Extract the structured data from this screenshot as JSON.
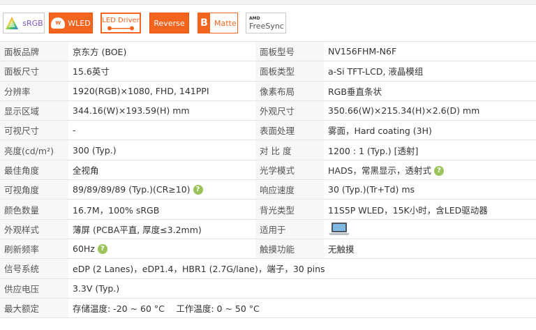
{
  "badges": {
    "srgb": "sRGB",
    "wled_bulb": "W",
    "wled": "WLED",
    "led_driver": "LED Driver",
    "reverse": "Reverse",
    "matte_letter": "B",
    "matte": "Matte",
    "amd": "AMD",
    "freesync": "FreeSync"
  },
  "colors": {
    "accent": "#f3641e",
    "help": "#9cc35a",
    "label_bg": "#f7f7f7",
    "border": "#e4e4e4"
  },
  "help_icon": "?",
  "specs": {
    "r1": {
      "k1": "面板品牌",
      "v1": "京东方 (BOE)",
      "k2": "面板型号",
      "v2": "NV156FHM-N6F"
    },
    "r2": {
      "k1": "面板尺寸",
      "v1": "15.6英寸",
      "k2": "面板类型",
      "v2": "a-Si TFT-LCD, 液晶模组"
    },
    "r3": {
      "k1": "分辨率",
      "v1": "1920(RGB)×1080, FHD, 141PPI",
      "k2": "像素布局",
      "v2": "RGB垂直条状"
    },
    "r4": {
      "k1": "显示区域",
      "v1": "344.16(W)×193.59(H) mm",
      "k2": "外观尺寸",
      "v2": "350.66(W)×215.34(H)×2.6(D) mm"
    },
    "r5": {
      "k1": "可视尺寸",
      "v1": "-",
      "k2": "表面处理",
      "v2": "雾面，Hard coating (3H)"
    },
    "r6": {
      "k1": "亮度(cd/m²)",
      "v1": "300 (Typ.)",
      "k2": "对 比 度",
      "v2": "1200 : 1 (Typ.) [透射]"
    },
    "r7": {
      "k1": "最佳角度",
      "v1": "全视角",
      "k2": "光学模式",
      "v2": "HADS，常黑显示，透射式"
    },
    "r8": {
      "k1": "可视角度",
      "v1": "89/89/89/89 (Typ.)(CR≥10)",
      "k2": "响应速度",
      "v2": "30 (Typ.)(Tr+Td) ms"
    },
    "r9": {
      "k1": "颜色数量",
      "v1": "16.7M，100% sRGB",
      "k2": "背光类型",
      "v2": "11S5P WLED，15K小时，含LED驱动器"
    },
    "r10": {
      "k1": "外观样式",
      "v1": "薄屏 (PCBA平直, 厚度≤3.2mm)",
      "k2": "适用于",
      "v2_icon": "laptop-icon"
    },
    "r11": {
      "k1": "刷新频率",
      "v1": "60Hz",
      "k2": "触摸功能",
      "v2": "无触摸"
    },
    "r12": {
      "k1": "信号系统",
      "v1": "eDP (2 Lanes)，eDP1.4，HBR1 (2.7G/lane)，端子，30 pins"
    },
    "r13": {
      "k1": "供应电压",
      "v1": "3.3V (Typ.)"
    },
    "r14": {
      "k1": "最大额定",
      "v1": "存储温度: -20 ~ 60 °C　 工作温度: 0 ~ 50 °C"
    }
  }
}
